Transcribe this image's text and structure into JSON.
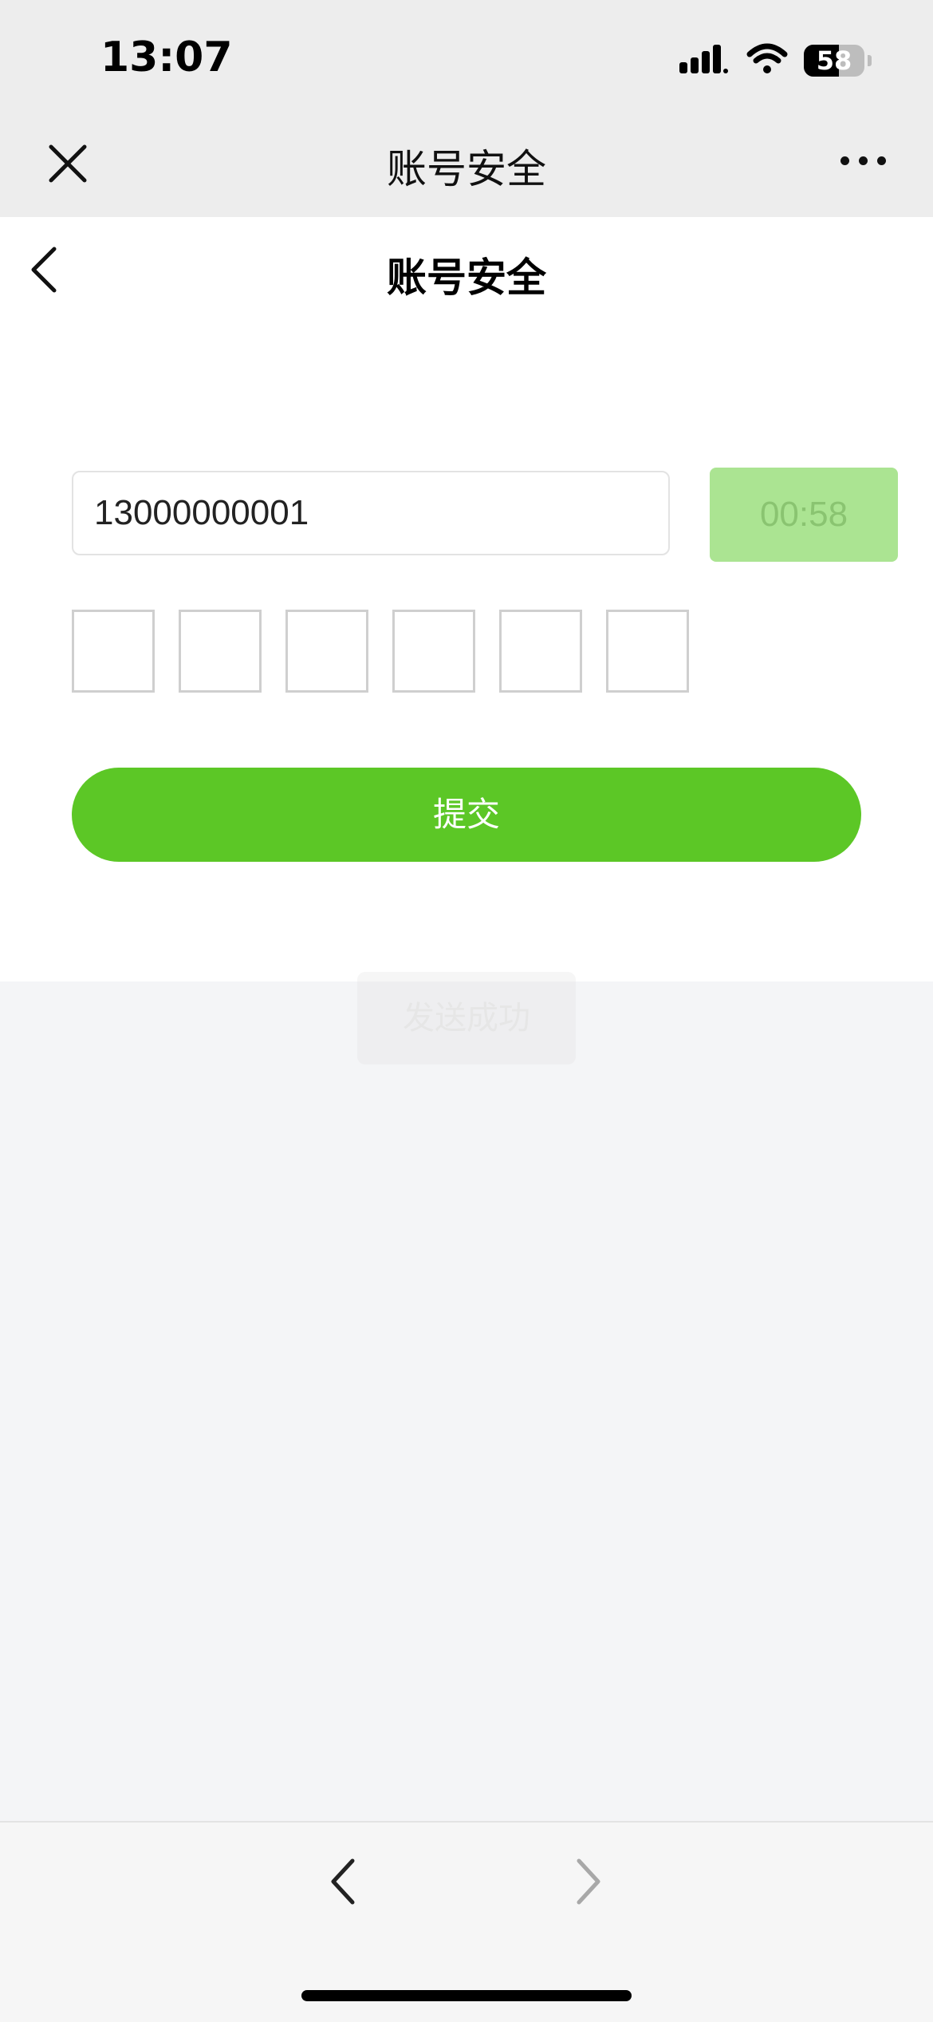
{
  "status_bar": {
    "time": "13:07",
    "battery_level": "58",
    "battery_fraction": 0.58,
    "icons": [
      "signal-icon",
      "wifi-icon",
      "battery-icon"
    ]
  },
  "top_bar": {
    "title": "账号安全",
    "close_icon": "close-icon",
    "more_icon": "more-icon"
  },
  "page": {
    "title": "账号安全",
    "back_icon": "chevron-left-icon",
    "phone_value": "13000000001",
    "countdown_label": "00:58",
    "code_boxes": [
      "",
      "",
      "",
      "",
      "",
      ""
    ],
    "submit_label": "提交",
    "toast": "发送成功"
  },
  "bottom_nav": {
    "back_icon": "chevron-left-icon",
    "forward_icon": "chevron-right-icon"
  },
  "colors": {
    "accent": "#5cc726",
    "countdown_bg": "#abe492",
    "chrome_bg": "#ededed",
    "page_bg": "#f4f5f7"
  }
}
